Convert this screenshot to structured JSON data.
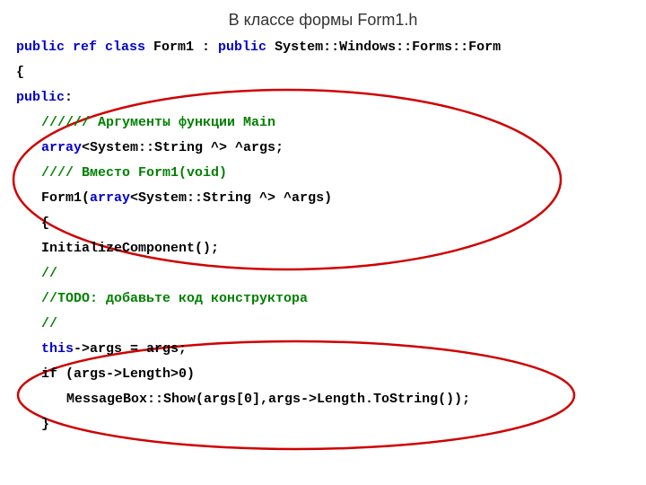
{
  "title": "В классе формы Form1.h",
  "code": {
    "l1_a": "public",
    "l1_b": " ref class",
    "l1_c": " Form1 : ",
    "l1_d": "public",
    "l1_e": " System::Windows::Forms::Form",
    "l2": "{",
    "l3_a": "public",
    "l3_b": ":",
    "l4": "////// Аргументы функции Main",
    "l5_a": "array",
    "l5_b": "<System::String ^> ^args;",
    "l6": "//// Вместо Form1(void)",
    "l7_a": "Form1(",
    "l7_b": "array",
    "l7_c": "<System::String ^> ^args)",
    "l8": "{",
    "l9": "InitializeComponent();",
    "l10": "//",
    "l11": "//TODO: добавьте код конструктора",
    "l12": "//",
    "l13_a": "this",
    "l13_b": "->args = args;",
    "l14": "if (args->Length>0)",
    "l15": "MessageBox::Show(args[0],args->Length.ToString());",
    "l16": "}"
  }
}
